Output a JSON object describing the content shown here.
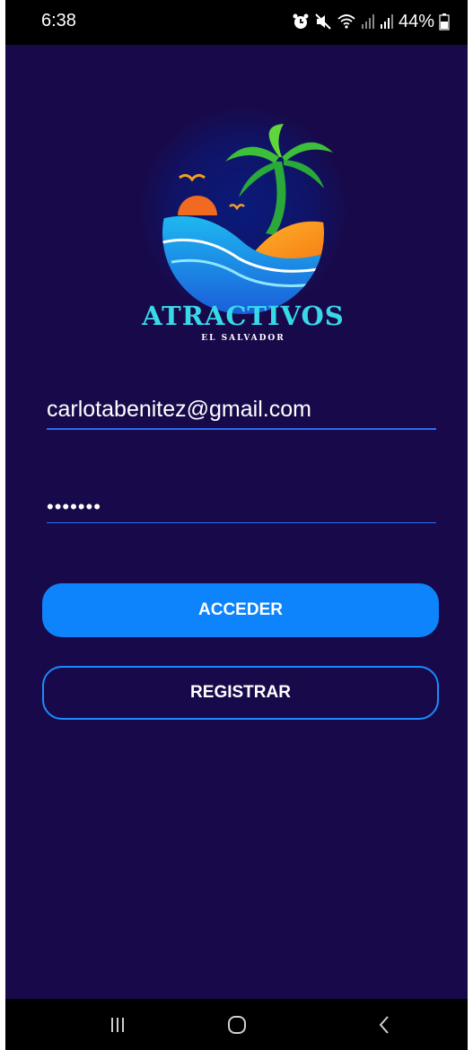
{
  "status_bar": {
    "time": "6:38",
    "battery": "44%",
    "icons": [
      "alarm-icon",
      "mute-icon",
      "wifi-icon",
      "signal-icon",
      "signal-icon",
      "battery-icon"
    ]
  },
  "brand": {
    "title": "ATRACTIVOS",
    "subtitle": "EL SALVADOR"
  },
  "login_form": {
    "email_value": "carlotabenitez@gmail.com",
    "password_value": "•••••••",
    "login_button": "ACCEDER",
    "register_button": "REGISTRAR"
  },
  "nav_bar": {
    "icons": [
      "recent-apps-icon",
      "home-icon",
      "back-icon"
    ]
  },
  "colors": {
    "background": "#180a4a",
    "primary_button": "#0d84fb",
    "underline": "#2b6ef2",
    "brand_title": "#37d9e8"
  }
}
